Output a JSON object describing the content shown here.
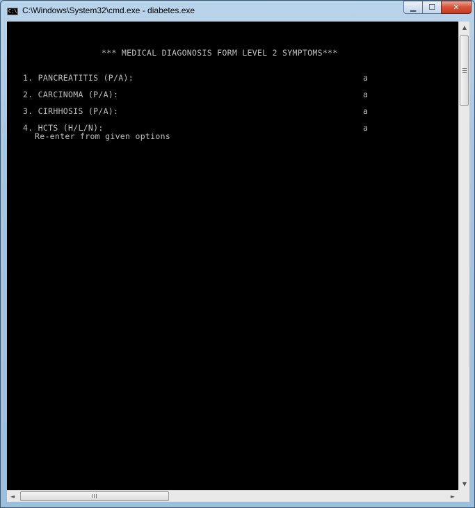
{
  "window": {
    "title": "C:\\Windows\\System32\\cmd.exe - diabetes.exe",
    "icon": "cmd-icon",
    "app_icon_text": "C:\\"
  },
  "controls": {
    "minimize": "▁",
    "maximize": "☐",
    "close": "✕"
  },
  "console": {
    "heading": "*** MEDICAL DIAGONOSIS FORM LEVEL 2 SYMPTOMS***",
    "items": [
      {
        "label": "1. PANCREATITIS (P/A):",
        "value": "a"
      },
      {
        "label": "2. CARCINOMA (P/A):",
        "value": "a"
      },
      {
        "label": "3. CIRHHOSIS (P/A):",
        "value": "a"
      },
      {
        "label": "4. HCTS (H/L/N):",
        "value": "a"
      }
    ],
    "message": "Re-enter from given options"
  },
  "scrollbars": {
    "up": "▲",
    "down": "▼",
    "left": "◄",
    "right": "►"
  },
  "colors": {
    "console_bg": "#000000",
    "console_text": "#c0c0c0",
    "close_button": "#c63b1f"
  }
}
